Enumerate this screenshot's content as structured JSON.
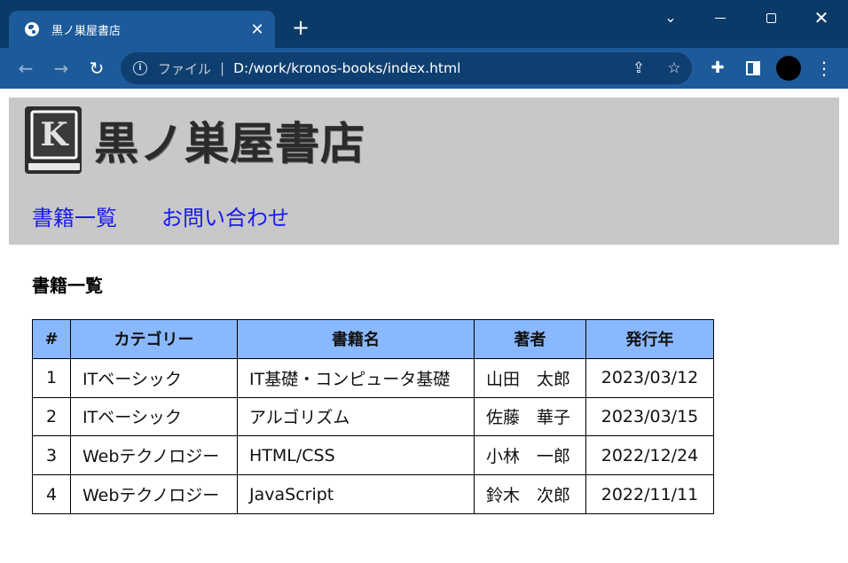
{
  "browser": {
    "tab_title": "黒ノ巣屋書店",
    "scheme_label": "ファイル",
    "url": "D:/work/kronos-books/index.html",
    "accent": "#1c5a99",
    "frame": "#0b3a68"
  },
  "site": {
    "logo_letter": "K",
    "name": "黒ノ巣屋書店",
    "nav": [
      {
        "label": "書籍一覧"
      },
      {
        "label": "お問い合わせ"
      }
    ],
    "header_bg": "#c8c8c8",
    "link_color": "#1a1aee"
  },
  "main": {
    "section_title": "書籍一覧",
    "table": {
      "header_bg": "#8ab8ff",
      "columns": [
        "#",
        "カテゴリー",
        "書籍名",
        "著者",
        "発行年"
      ],
      "rows": [
        {
          "no": "1",
          "category": "ITベーシック",
          "title": "IT基礎・コンピュータ基礎",
          "author": "山田　太郎",
          "date": "2023/03/12"
        },
        {
          "no": "2",
          "category": "ITベーシック",
          "title": "アルゴリズム",
          "author": "佐藤　華子",
          "date": "2023/03/15"
        },
        {
          "no": "3",
          "category": "Webテクノロジー",
          "title": "HTML/CSS",
          "author": "小林　一郎",
          "date": "2022/12/24"
        },
        {
          "no": "4",
          "category": "Webテクノロジー",
          "title": "JavaScript",
          "author": "鈴木　次郎",
          "date": "2022/11/11"
        }
      ]
    }
  }
}
